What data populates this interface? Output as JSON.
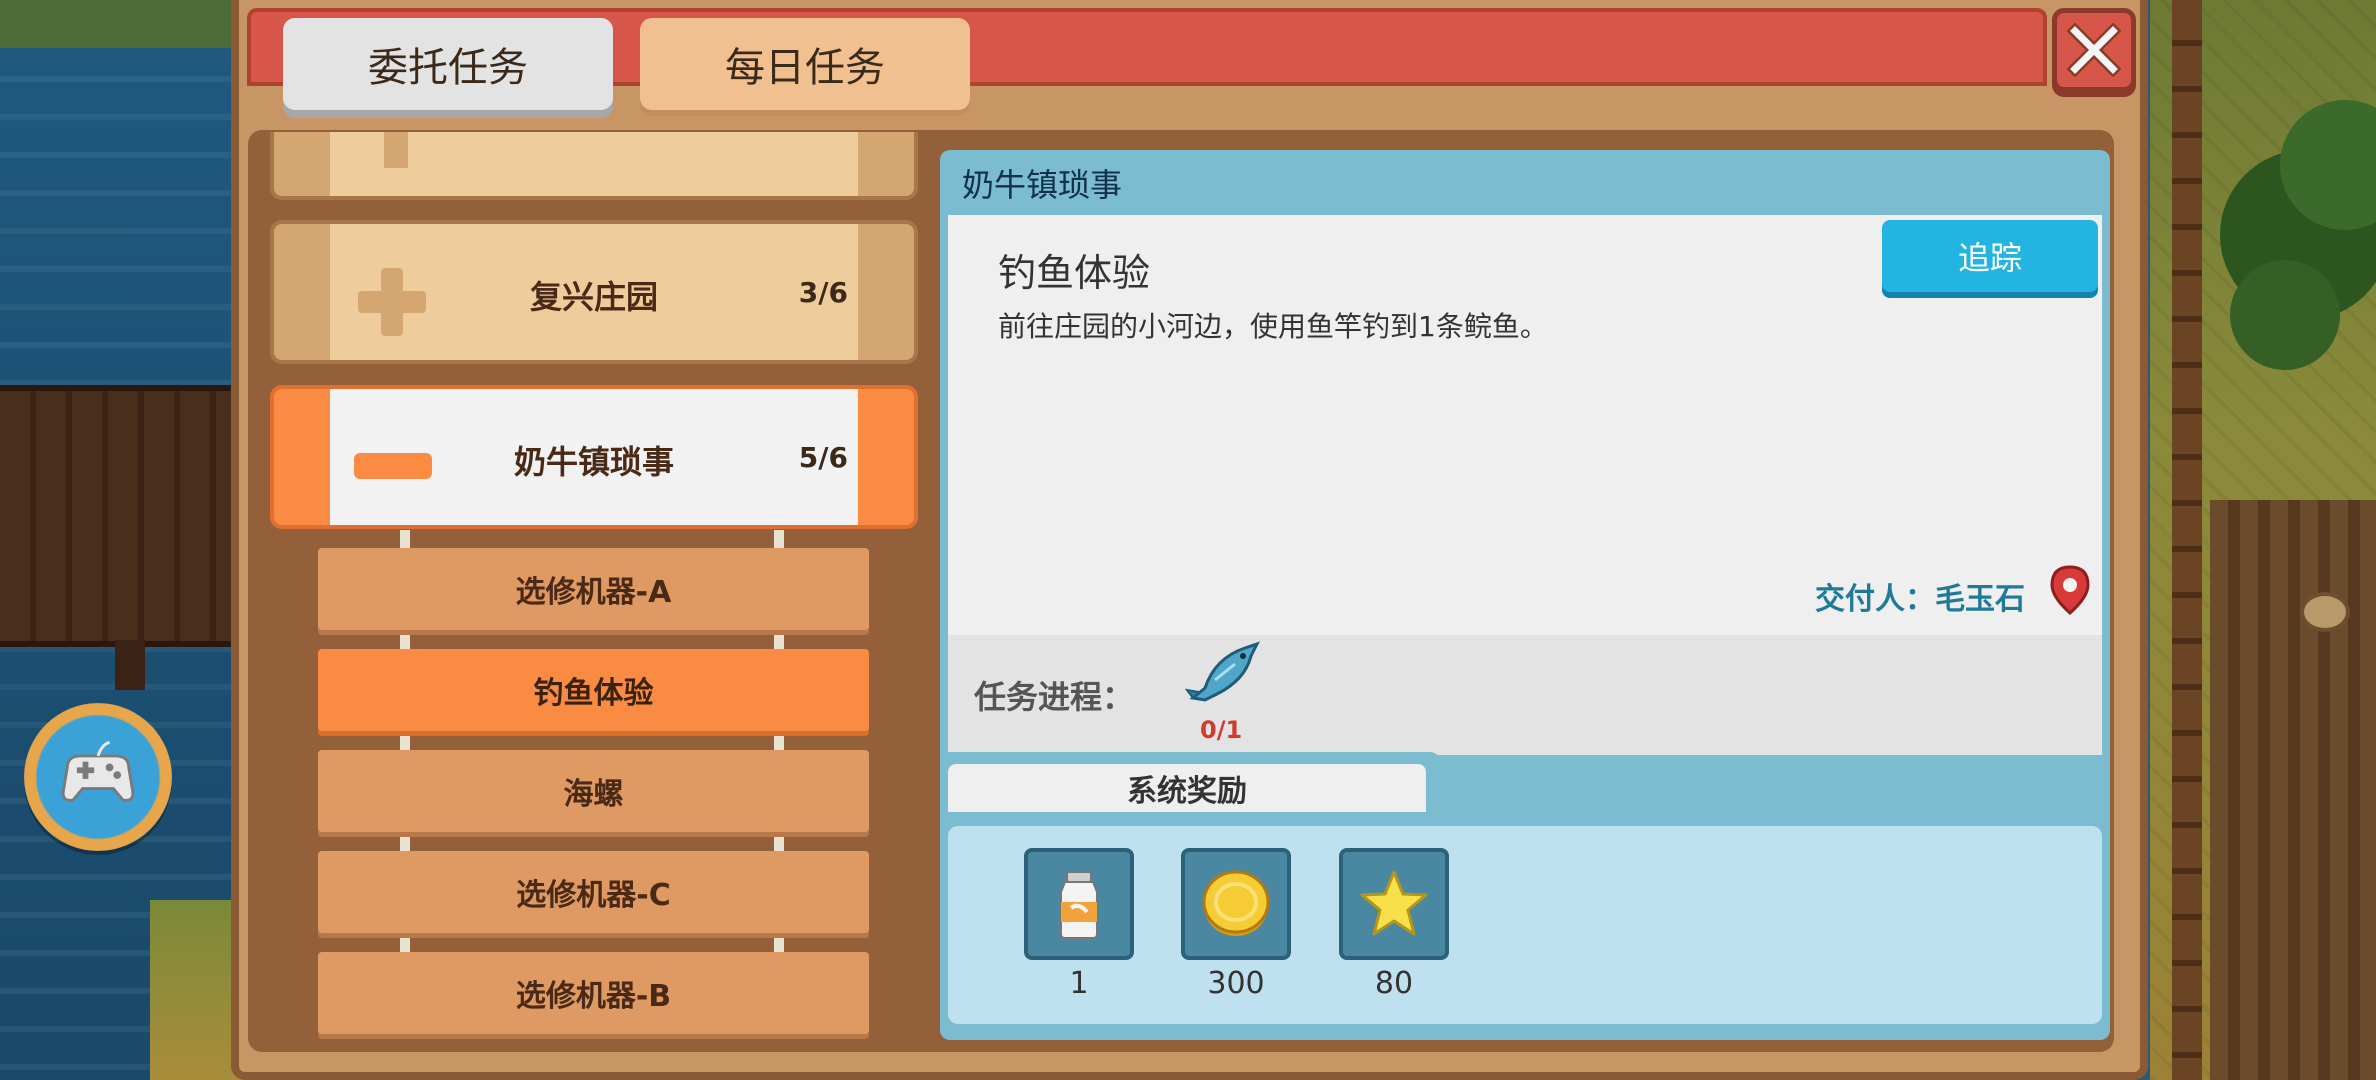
{
  "tabs": [
    {
      "label": "委托任务",
      "active": true
    },
    {
      "label": "每日任务",
      "active": false
    }
  ],
  "quest_categories": [
    {
      "title": "",
      "count": "",
      "expanded": false,
      "partial": true
    },
    {
      "title": "复兴庄园",
      "count": "3/6",
      "expanded": false
    },
    {
      "title": "奶牛镇琐事",
      "count": "5/6",
      "expanded": true
    }
  ],
  "sub_quests": [
    {
      "label": "选修机器-A",
      "active": false
    },
    {
      "label": "钓鱼体验",
      "active": true
    },
    {
      "label": "海螺",
      "active": false
    },
    {
      "label": "选修机器-C",
      "active": false
    },
    {
      "label": "选修机器-B",
      "active": false
    }
  ],
  "detail": {
    "category_title": "奶牛镇琐事",
    "quest_name": "钓鱼体验",
    "description": "前往庄园的小河边，使用鱼竿钓到1条鲩鱼。",
    "track_button": "追踪",
    "giver": "交付人：毛玉石",
    "progress_label": "任务进程：",
    "progress_item": "fish-icon",
    "progress_count": "0/1",
    "rewards_tab": "系统奖励",
    "rewards": [
      {
        "icon": "milk-bottle-icon",
        "amount": "1"
      },
      {
        "icon": "gold-coin-icon",
        "amount": "300"
      },
      {
        "icon": "star-icon",
        "amount": "80"
      }
    ]
  },
  "colors": {
    "header_red": "#d6574a",
    "active_orange": "#fa8b42",
    "track_blue": "#24b4e2",
    "progress_red": "#d23a2a",
    "giver_teal": "#1f7a9a"
  }
}
